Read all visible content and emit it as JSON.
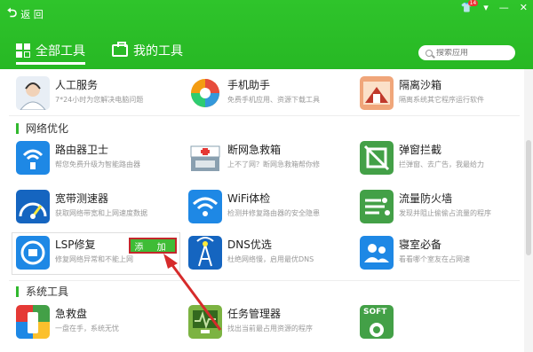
{
  "header": {
    "back_label": "返 回",
    "tabs": [
      {
        "label": "全部工具"
      },
      {
        "label": "我的工具"
      }
    ],
    "search_placeholder": "搜索应用",
    "window_controls": {
      "skin_badge": "14"
    }
  },
  "sections": {
    "network": "网络优化",
    "system": "系统工具"
  },
  "items": {
    "human": {
      "name": "人工服务",
      "desc": "7*24小时为您解决电脑问题"
    },
    "phone": {
      "name": "手机助手",
      "desc": "免费手机应用、资源下载工具"
    },
    "sandbox": {
      "name": "隔离沙箱",
      "desc": "隔离系统其它程序运行软件"
    },
    "router": {
      "name": "路由器卫士",
      "desc": "帮您免费升级为智能路由器"
    },
    "netbox": {
      "name": "断网急救箱",
      "desc": "上不了网？断网急救箱帮你修"
    },
    "popup": {
      "name": "弹窗拦截",
      "desc": "拦弹窗、去广告，我最给力"
    },
    "speed": {
      "name": "宽带测速器",
      "desc": "获取网络带宽和上网速度数据"
    },
    "wifi": {
      "name": "WiFi体检",
      "desc": "检测并修复路由器的安全隐患"
    },
    "firewall": {
      "name": "流量防火墙",
      "desc": "发现并阻止偷偷占流量的程序"
    },
    "lsp": {
      "name": "LSP修复",
      "desc": "修复网络异常和不能上网",
      "button": "添 加"
    },
    "dns": {
      "name": "DNS优选",
      "desc": "杜绝网络慢，启用最优DNS"
    },
    "dorm": {
      "name": "寝室必备",
      "desc": "看看哪个室友在占网速"
    },
    "rescue": {
      "name": "急救盘",
      "desc": "一盘在手，系统无忧"
    },
    "taskmgr": {
      "name": "任务管理器",
      "desc": "找出当前最占用资源的程序"
    },
    "soft": {
      "name": "",
      "desc": ""
    }
  },
  "icons": {
    "soft_label": "SOFT"
  },
  "colors": {
    "header_green": "#2fc42b",
    "accent_red": "#c3272b",
    "button_green": "#3fbc36"
  }
}
